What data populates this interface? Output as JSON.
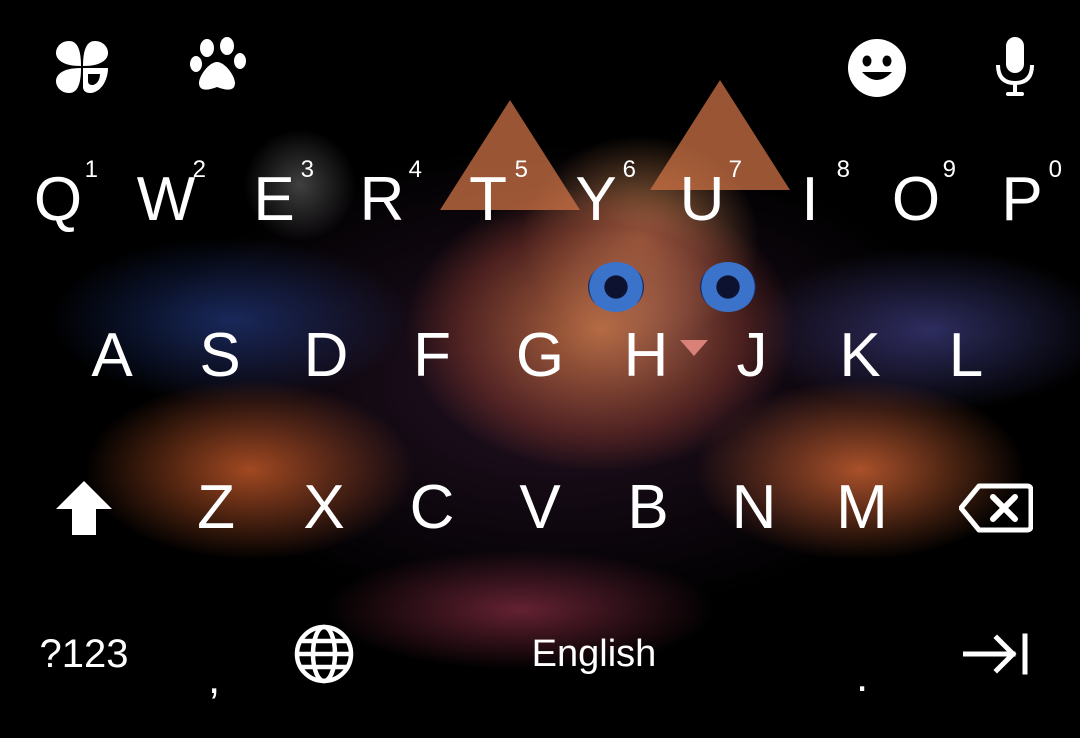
{
  "toolbar": {
    "clover_icon": "clover-icon",
    "paw_icon": "paw-icon",
    "emoji_icon": "emoji-icon",
    "mic_icon": "microphone-icon"
  },
  "row1": [
    {
      "letter": "Q",
      "hint": "1"
    },
    {
      "letter": "W",
      "hint": "2"
    },
    {
      "letter": "E",
      "hint": "3"
    },
    {
      "letter": "R",
      "hint": "4"
    },
    {
      "letter": "T",
      "hint": "5"
    },
    {
      "letter": "Y",
      "hint": "6"
    },
    {
      "letter": "U",
      "hint": "7"
    },
    {
      "letter": "I",
      "hint": "8"
    },
    {
      "letter": "O",
      "hint": "9"
    },
    {
      "letter": "P",
      "hint": "0"
    }
  ],
  "row2": [
    {
      "letter": "A"
    },
    {
      "letter": "S"
    },
    {
      "letter": "D"
    },
    {
      "letter": "F"
    },
    {
      "letter": "G"
    },
    {
      "letter": "H"
    },
    {
      "letter": "J"
    },
    {
      "letter": "K"
    },
    {
      "letter": "L"
    }
  ],
  "row3": [
    {
      "letter": "Z"
    },
    {
      "letter": "X"
    },
    {
      "letter": "C"
    },
    {
      "letter": "V"
    },
    {
      "letter": "B"
    },
    {
      "letter": "N"
    },
    {
      "letter": "M"
    }
  ],
  "bottom": {
    "symbols_label": "?123",
    "comma_label": ",",
    "space_label": "English",
    "period_label": "."
  },
  "icons": {
    "shift": "shift-icon",
    "backspace": "backspace-icon",
    "globe": "globe-icon",
    "enter": "tab-arrow-icon"
  }
}
